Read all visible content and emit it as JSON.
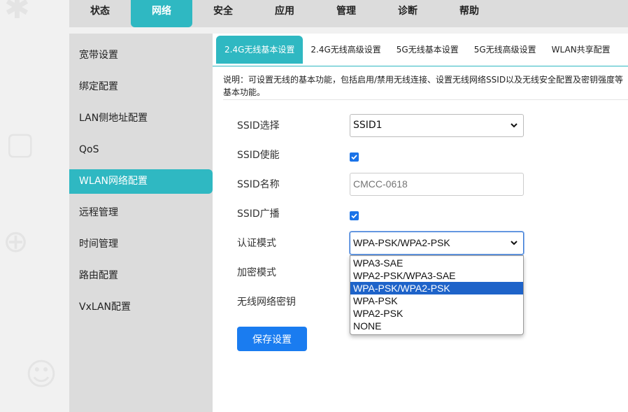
{
  "top_nav": {
    "items": [
      {
        "label": "状态"
      },
      {
        "label": "网络"
      },
      {
        "label": "安全"
      },
      {
        "label": "应用"
      },
      {
        "label": "管理"
      },
      {
        "label": "诊断"
      },
      {
        "label": "帮助"
      }
    ],
    "active_index": 1
  },
  "sidebar": {
    "items": [
      {
        "label": "宽带设置"
      },
      {
        "label": "绑定配置"
      },
      {
        "label": "LAN侧地址配置"
      },
      {
        "label": "QoS"
      },
      {
        "label": "WLAN网络配置"
      },
      {
        "label": "远程管理"
      },
      {
        "label": "时间管理"
      },
      {
        "label": "路由配置"
      },
      {
        "label": "VxLAN配置"
      }
    ],
    "active_index": 4
  },
  "tabs": {
    "items": [
      {
        "label": "2.4G无线基本设置"
      },
      {
        "label": "2.4G无线高级设置"
      },
      {
        "label": "5G无线基本设置"
      },
      {
        "label": "5G无线高级设置"
      },
      {
        "label": "WLAN共享配置"
      }
    ],
    "active_index": 0
  },
  "description": "说明：可设置无线的基本功能，包括启用/禁用无线连接、设置无线网络SSID以及无线安全配置及密钥强度等基本功能。",
  "form": {
    "ssid_select": {
      "label": "SSID选择",
      "value": "SSID1"
    },
    "ssid_enable": {
      "label": "SSID使能",
      "checked": true
    },
    "ssid_name": {
      "label": "SSID名称",
      "placeholder": "CMCC-0618"
    },
    "ssid_broadcast": {
      "label": "SSID广播",
      "checked": true
    },
    "auth_mode": {
      "label": "认证模式",
      "value": "WPA-PSK/WPA2-PSK",
      "options": [
        "WPA3-SAE",
        "WPA2-PSK/WPA3-SAE",
        "WPA-PSK/WPA2-PSK",
        "WPA-PSK",
        "WPA2-PSK",
        "NONE"
      ],
      "selected_index": 2
    },
    "encryption_mode": {
      "label": "加密模式"
    },
    "wireless_key": {
      "label": "无线网络密钥"
    }
  },
  "save_button": {
    "label": "保存设置"
  },
  "colors": {
    "accent": "#2fb8c2",
    "primary_button": "#1a7cf0",
    "selected_option": "#1e63c9"
  }
}
